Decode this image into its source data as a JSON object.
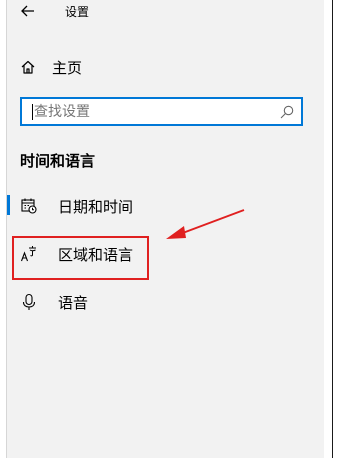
{
  "header": {
    "back_icon": "arrow-left-icon",
    "title": "设置"
  },
  "home": {
    "icon": "home-icon",
    "label": "主页"
  },
  "search": {
    "placeholder": "查找设置",
    "value": "",
    "icon": "search-icon"
  },
  "section": {
    "title": "时间和语言"
  },
  "nav": {
    "items": [
      {
        "icon": "calendar-clock-icon",
        "label": "日期和时间",
        "selected": true
      },
      {
        "icon": "language-icon",
        "label": "区域和语言",
        "selected": false,
        "highlighted": true
      },
      {
        "icon": "microphone-icon",
        "label": "语音",
        "selected": false
      }
    ]
  },
  "colors": {
    "accent": "#0078d7",
    "sidebar_bg": "#f2f2f2",
    "annotation": "#e02020"
  }
}
